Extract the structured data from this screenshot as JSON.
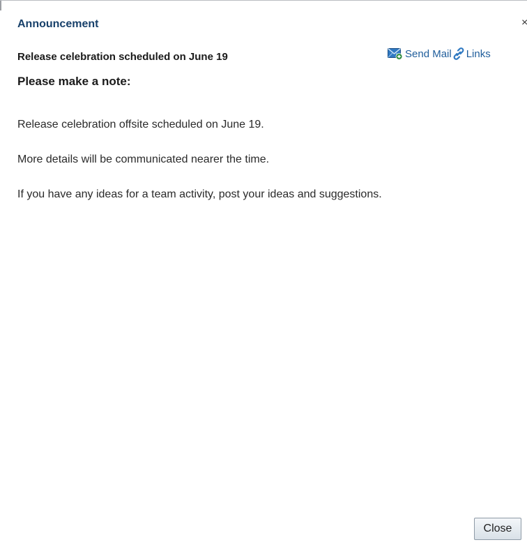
{
  "dialog": {
    "title": "Announcement",
    "close_glyph": "×",
    "close_icon": "close-icon"
  },
  "announcement": {
    "subject": "Release celebration scheduled on June 19",
    "actions": {
      "send_mail_label": "Send Mail",
      "send_mail_icon": "envelope-plus-icon",
      "links_label": "Links",
      "links_icon": "link-chain-icon"
    },
    "note_heading": "Please make a note:",
    "paragraphs": [
      "Release celebration offsite scheduled on June 19.",
      "More details will be communicated nearer the time.",
      "If you have any ideas for a team activity, post your ideas and suggestions."
    ]
  },
  "footer": {
    "close_label": "Close"
  },
  "colors": {
    "title": "#17406a",
    "link": "#1f5d9b",
    "text": "#2a2a2a"
  }
}
